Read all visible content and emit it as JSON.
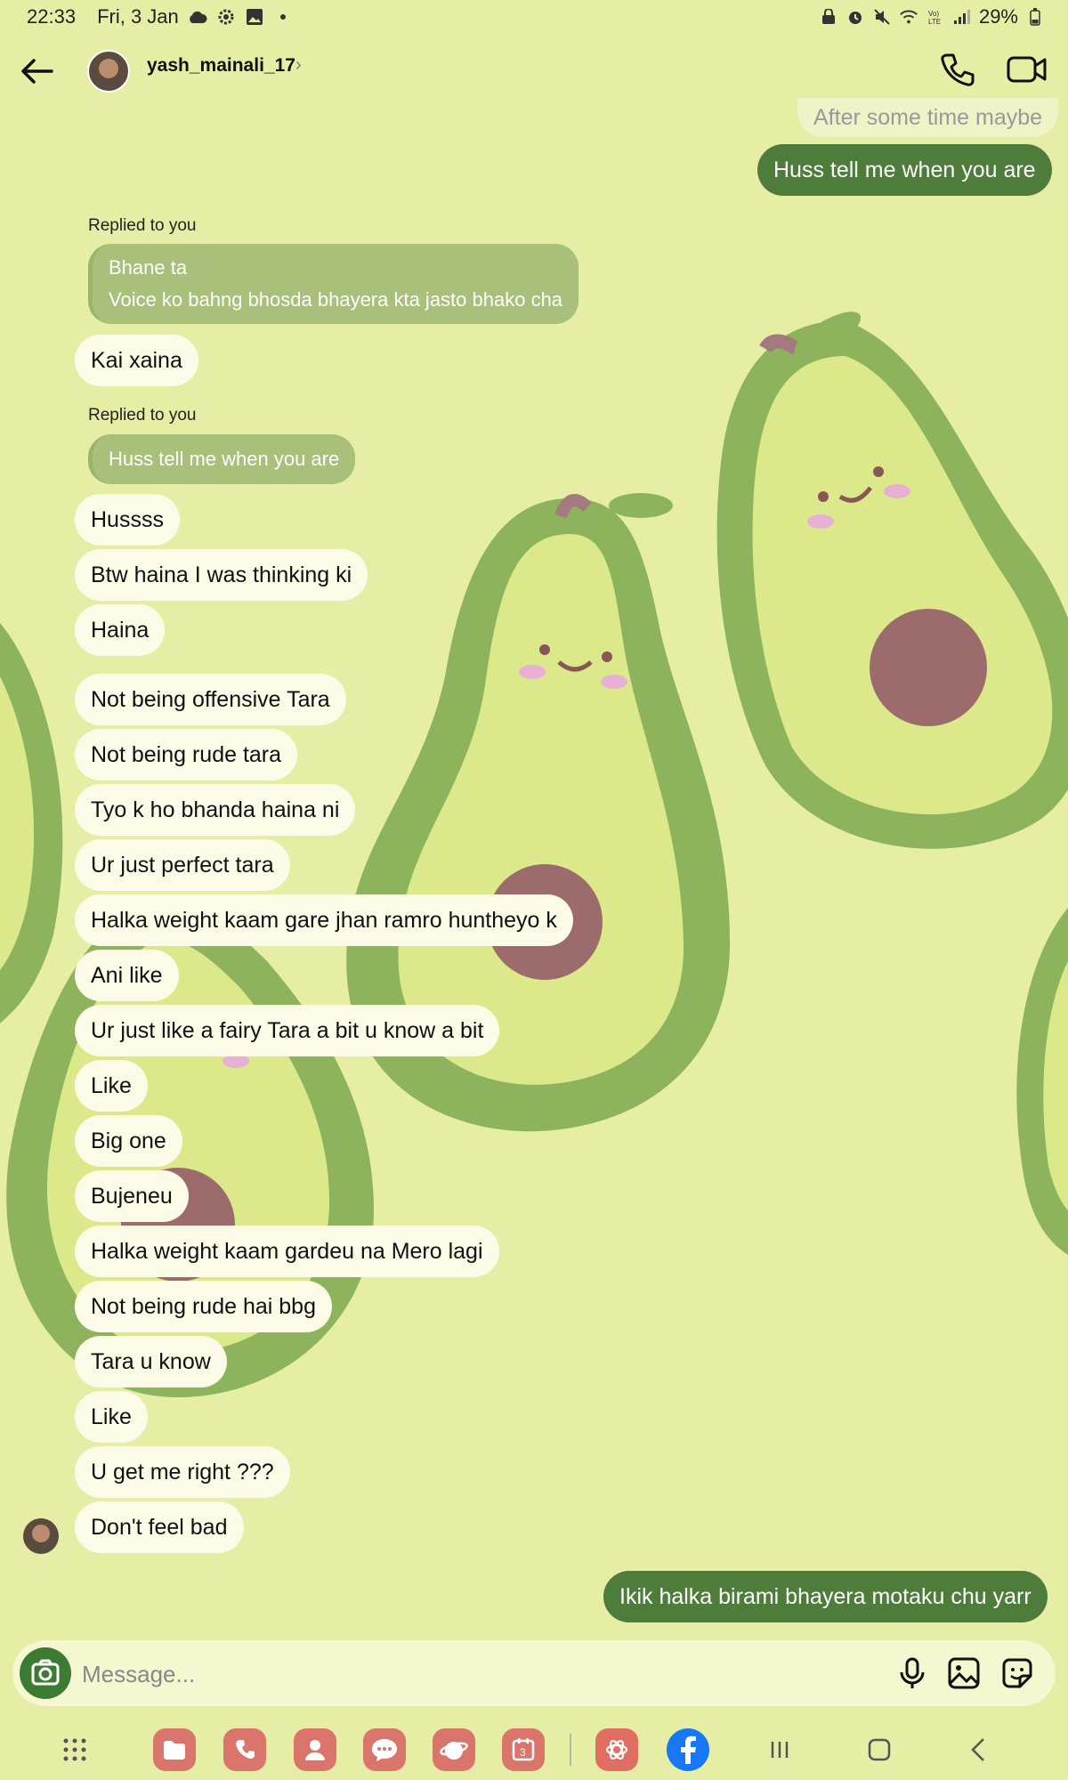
{
  "status": {
    "time": "22:33",
    "date": "Fri, 3 Jan",
    "battery": "29%"
  },
  "header": {
    "username": "yash_mainali_17",
    "chevron": "›"
  },
  "messages": {
    "prev_faded": "After some time maybe",
    "out1": "Huss tell me when you are",
    "reply1_label": "Replied to you",
    "reply1_line1": "Bhane ta",
    "reply1_line2": "Voice ko bahng bhosda bhayera kta jasto bhako cha",
    "m1": "Kai xaina",
    "reply2_label": "Replied to you",
    "reply2_quote": "Huss tell me when you are",
    "m2": "Hussss",
    "m3": "Btw haina I was thinking ki",
    "m4": "Haina",
    "m5": "Not being offensive Tara",
    "m6": "Not being rude tara",
    "m7": "Tyo k ho bhanda haina ni",
    "m8": "Ur just perfect tara",
    "m9": "Halka weight kaam gare jhan ramro huntheyo k",
    "m10": "Ani like",
    "m11": "Ur just like a fairy Tara a bit u know a bit",
    "m12": "Like",
    "m13": "Big one",
    "m14": "Bujeneu",
    "m15": "Halka weight kaam gardeu na Mero lagi",
    "m16": "Not being rude hai bbg",
    "m17": "Tara u know",
    "m18": "Like",
    "m19": "U get me right ???",
    "m20": "Don't feel bad",
    "out2": "Ikik halka birami bhayera motaku chu yarr"
  },
  "composer": {
    "placeholder": "Message..."
  },
  "icons": {
    "back": "arrow-left-icon",
    "call": "phone-icon",
    "video": "video-camera-icon",
    "camera": "camera-icon",
    "mic": "microphone-icon",
    "gallery": "image-icon",
    "sticker": "sticker-icon"
  },
  "colors": {
    "background": "#e6eea6",
    "incoming_bubble": "#fbfbe8",
    "outgoing_bubble": "#4e7c3a",
    "reply_quote": "#a8c07a",
    "avocado_skin": "#8db35c",
    "avocado_flesh": "#dbe98a",
    "avocado_pit": "#9c6b6b"
  }
}
